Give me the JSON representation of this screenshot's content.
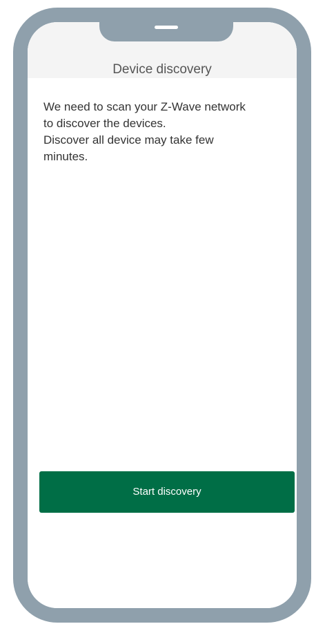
{
  "header": {
    "title": "Device discovery"
  },
  "main": {
    "message_lines": [
      "We need to scan your Z-Wave network",
      "to discover the devices.",
      "Discover all device may take few",
      "minutes."
    ],
    "start_button_label": "Start discovery"
  },
  "colors": {
    "frame": "#8fa0ac",
    "header_background": "#f4f4f4",
    "primary_button": "#006e46",
    "button_text": "#ffffff"
  }
}
